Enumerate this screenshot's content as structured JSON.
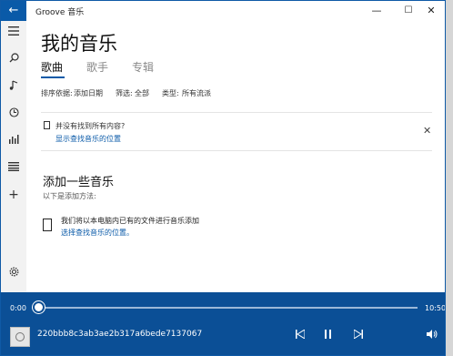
{
  "window": {
    "app_title": "Groove 音乐",
    "controls": {
      "minimize": "—",
      "maximize": "☐",
      "close": "✕"
    }
  },
  "sidebar": {
    "back": "←",
    "icons": [
      "hamburger-icon",
      "search-icon",
      "music-note-icon",
      "recent-icon",
      "chart-icon",
      "playlist-icon",
      "add-icon",
      "settings-icon"
    ]
  },
  "page": {
    "title": "我的音乐",
    "tabs": [
      {
        "label": "歌曲",
        "active": true
      },
      {
        "label": "歌手",
        "active": false
      },
      {
        "label": "专辑",
        "active": false
      }
    ]
  },
  "filters": {
    "sort_label": "排序依据:",
    "sort_value": "添加日期",
    "filter_label": "筛选:",
    "filter_value": "全部",
    "type_label": "类型:",
    "type_value": "所有流派"
  },
  "notice": {
    "text": "并没有找到所有内容?",
    "link": "显示查找音乐的位置"
  },
  "add_music": {
    "heading": "添加一些音乐",
    "subheading": "以下是添加方法:",
    "option_text": "我们将以本电脑内已有的文件进行音乐添加",
    "option_link": "选择查找音乐的位置。"
  },
  "player": {
    "current_time": "0:00",
    "total_time": "10:50",
    "progress": 0.0,
    "track_name": "220bbb8c3ab3ae2b317a6bede7137067"
  },
  "colors": {
    "accent": "#0a5aa8",
    "player_bg": "#0b4f96"
  }
}
